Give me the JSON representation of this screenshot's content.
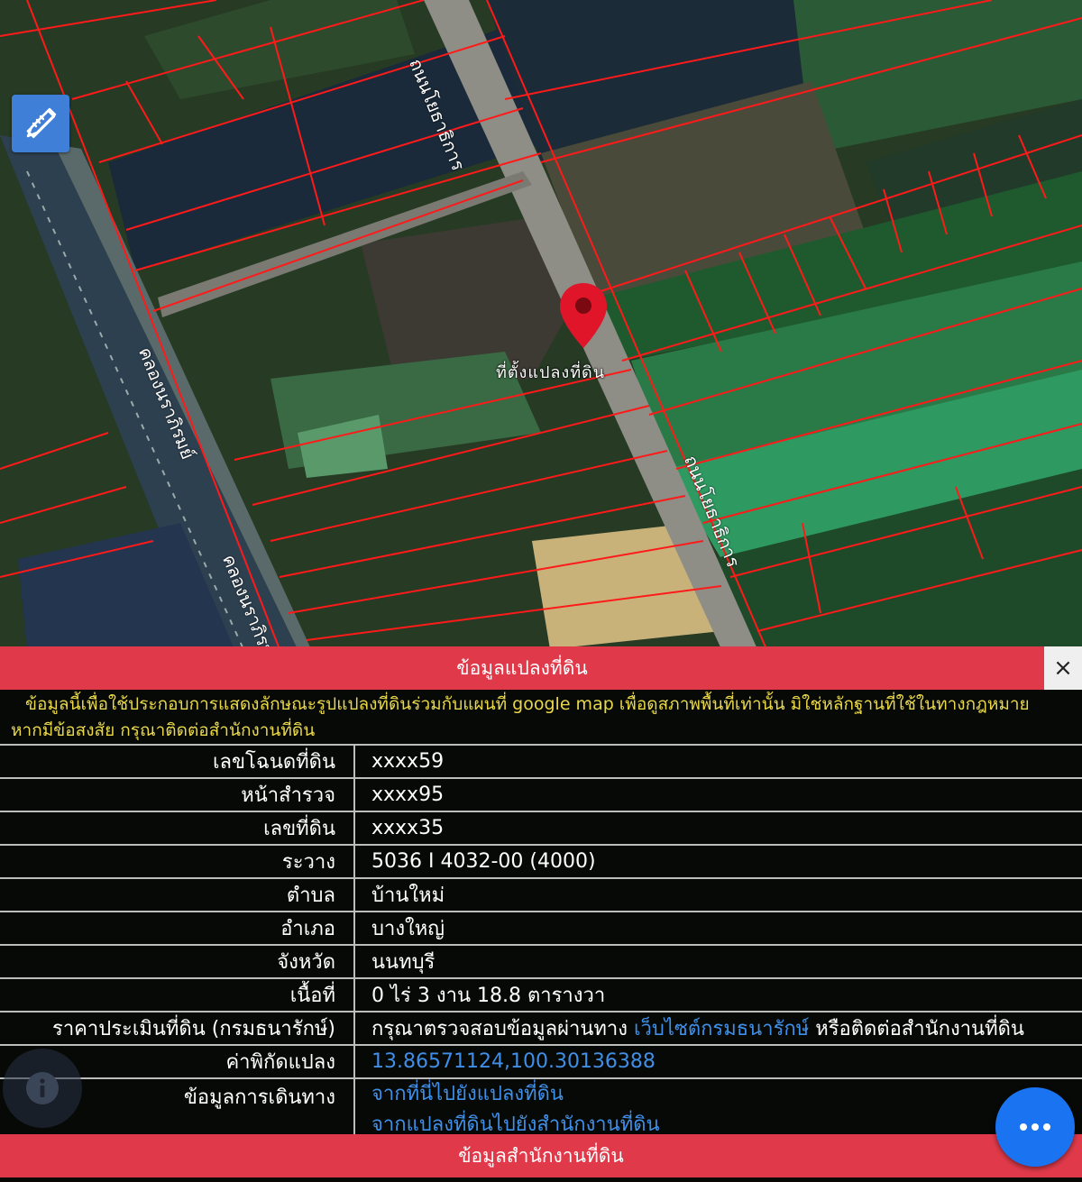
{
  "map": {
    "pin_label": "ที่ตั้งแปลงที่ดิน",
    "road_label_1": "ถนนโยธาธิการ",
    "road_label_2": "ถนนโยธาธิการ",
    "canal_label_1": "คลองนราภิรมย์",
    "canal_label_2": "คลองนราภิรมย์",
    "pin_color": "#e0152a",
    "parcel_line_color": "#ff1a1a"
  },
  "toolbar": {
    "draw_tool_icon": "ruler-pencil-icon"
  },
  "panel": {
    "title": "ข้อมูลแปลงที่ดิน",
    "close_label": "×",
    "notice_line1": "ข้อมูลนี้เพื่อใช้ประกอบการแสดงลักษณะรูปแปลงที่ดินร่วมกับแผนที่ google map เพื่อดูสภาพพื้นที่เท่านั้น มิใช่หลักฐานที่ใช้ในทางกฎหมาย",
    "notice_line2": "หากมีข้อสงสัย กรุณาติดต่อสำนักงานที่ดิน",
    "rows": [
      {
        "key": "เลขโฉนดที่ดิน",
        "value": "xxxx59"
      },
      {
        "key": "หน้าสำรวจ",
        "value": "xxxx95"
      },
      {
        "key": "เลขที่ดิน",
        "value": "xxxx35"
      },
      {
        "key": "ระวาง",
        "value": "5036 I 4032-00 (4000)"
      },
      {
        "key": "ตำบล",
        "value": "บ้านใหม่"
      },
      {
        "key": "อำเภอ",
        "value": "บางใหญ่"
      },
      {
        "key": "จังหวัด",
        "value": "นนทบุรี"
      },
      {
        "key": "เนื้อที่",
        "value": "0 ไร่ 3 งาน 18.8 ตารางวา"
      }
    ],
    "price": {
      "key": "ราคาประเมินที่ดิน (กรมธนารักษ์)",
      "prefix": "กรุณาตรวจสอบข้อมูลผ่านทาง",
      "link": "เว็บไซต์กรมธนารักษ์",
      "suffix": "หรือติดต่อสำนักงานที่ดิน"
    },
    "coords": {
      "key": "ค่าพิกัดแปลง",
      "value": "13.86571124,100.30136388"
    },
    "travel": {
      "key": "ข้อมูลการเดินทาง",
      "link1": "จากที่นี่ไปยังแปลงที่ดิน",
      "link2": "จากแปลงที่ดินไปยังสำนักงานที่ดิน"
    },
    "footer_title": "ข้อมูลสำนักงานที่ดิน"
  },
  "fabs": {
    "info_icon": "info-icon",
    "more_icon": "more-dots-icon"
  },
  "colors": {
    "header_red": "#e03a4a",
    "link_blue": "#3f8fe8",
    "notice_yellow": "#e9d84a",
    "fab_blue": "#1a73f0"
  }
}
